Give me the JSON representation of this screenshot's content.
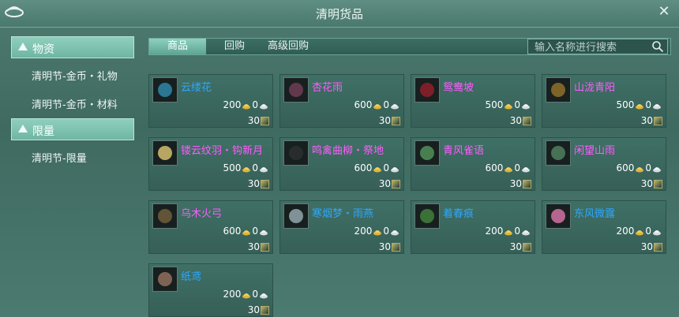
{
  "window": {
    "title": "清明货品"
  },
  "sidebar": {
    "categories": [
      {
        "label": "物资",
        "items": [
          "清明节-金币・礼物",
          "清明节-金币・材料"
        ]
      },
      {
        "label": "限量",
        "items": [
          "清明节-限量"
        ]
      }
    ]
  },
  "tabs": [
    "商品",
    "回购",
    "高级回购"
  ],
  "search": {
    "placeholder": "输入名称进行搜索"
  },
  "colors": {
    "name_blue": "#2ea7ff",
    "name_purple": "#ff5cff",
    "accent_teal": "#8ed0bf"
  },
  "items": [
    {
      "name": "云缕花",
      "price": "200",
      "zero": "0",
      "qty": "30",
      "color": "blue",
      "icon": "flower-icon"
    },
    {
      "name": "杏花雨",
      "price": "600",
      "zero": "0",
      "qty": "30",
      "color": "purple",
      "icon": "petal-icon"
    },
    {
      "name": "鸳鸯坡",
      "price": "500",
      "zero": "0",
      "qty": "30",
      "color": "purple",
      "icon": "red-fan-icon"
    },
    {
      "name": "山泷青阳",
      "price": "500",
      "zero": "0",
      "qty": "30",
      "color": "purple",
      "icon": "box-icon"
    },
    {
      "name": "镂云纹羽・钩新月",
      "price": "500",
      "zero": "0",
      "qty": "30",
      "color": "purple",
      "icon": "egg-icon"
    },
    {
      "name": "鸣禽曲柳・祭地",
      "price": "600",
      "zero": "0",
      "qty": "30",
      "color": "purple",
      "icon": "willow-icon"
    },
    {
      "name": "青风雀语",
      "price": "600",
      "zero": "0",
      "qty": "30",
      "color": "purple",
      "icon": "ring-icon"
    },
    {
      "name": "闲望山雨",
      "price": "600",
      "zero": "0",
      "qty": "30",
      "color": "purple",
      "icon": "hook-icon"
    },
    {
      "name": "乌木火弓",
      "price": "600",
      "zero": "0",
      "qty": "30",
      "color": "purple",
      "icon": "bow-icon"
    },
    {
      "name": "寒烟梦・雨燕",
      "price": "200",
      "zero": "0",
      "qty": "30",
      "color": "blue",
      "icon": "swallow-icon"
    },
    {
      "name": "着春痕",
      "price": "200",
      "zero": "0",
      "qty": "30",
      "color": "blue",
      "icon": "leaf-icon"
    },
    {
      "name": "东风微露",
      "price": "200",
      "zero": "0",
      "qty": "30",
      "color": "blue",
      "icon": "blossom-icon"
    },
    {
      "name": "纸鸢",
      "price": "200",
      "zero": "0",
      "qty": "30",
      "color": "blue",
      "icon": "kite-icon"
    }
  ]
}
